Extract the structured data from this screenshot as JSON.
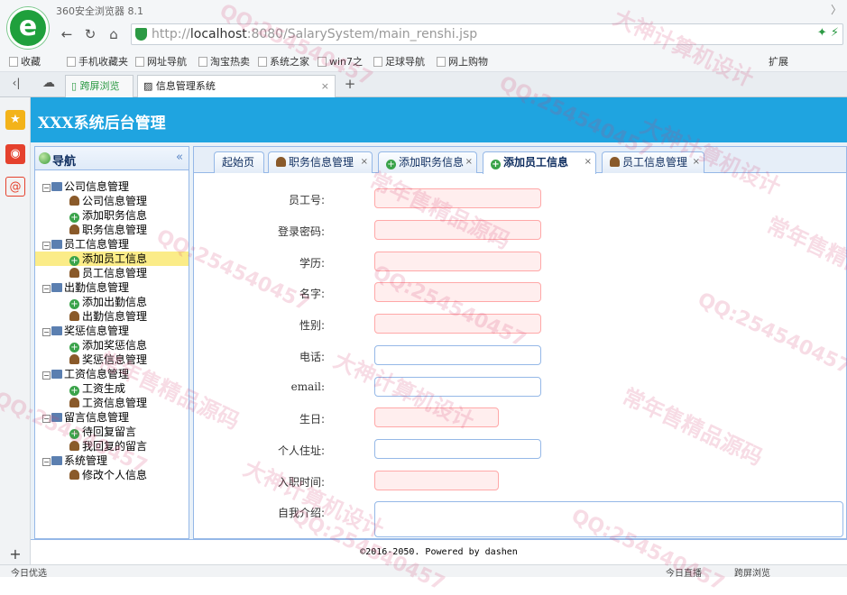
{
  "browser": {
    "title": "360安全浏览器 8.1",
    "url_prefix": "http://",
    "url_host": "localhost",
    "url_rest": ":8080/SalarySystem/main_renshi.jsp",
    "bookmarks": [
      "收藏",
      "手机收藏夹",
      "网址导航",
      "淘宝热卖",
      "系统之家",
      "win7之",
      "足球导航",
      "网上购物"
    ],
    "ext_label": "扩展",
    "tabs": [
      {
        "label": "跨屏浏览"
      },
      {
        "label": "信息管理系统"
      }
    ]
  },
  "app": {
    "title": "XXX系统后台管理",
    "nav_title": "导航",
    "collapse_glyph": "«",
    "tree": [
      {
        "label": "公司信息管理",
        "level": 0,
        "icon": "folder-computer-icon"
      },
      {
        "label": "公司信息管理",
        "level": 1,
        "icon": "person-icon"
      },
      {
        "label": "添加职务信息",
        "level": 1,
        "icon": "add-icon"
      },
      {
        "label": "职务信息管理",
        "level": 1,
        "icon": "person-icon"
      },
      {
        "label": "员工信息管理",
        "level": 0,
        "icon": "folder-computer-icon"
      },
      {
        "label": "添加员工信息",
        "level": 1,
        "icon": "add-icon",
        "selected": true
      },
      {
        "label": "员工信息管理",
        "level": 1,
        "icon": "person-icon"
      },
      {
        "label": "出勤信息管理",
        "level": 0,
        "icon": "folder-computer-icon"
      },
      {
        "label": "添加出勤信息",
        "level": 1,
        "icon": "add-icon"
      },
      {
        "label": "出勤信息管理",
        "level": 1,
        "icon": "person-icon"
      },
      {
        "label": "奖惩信息管理",
        "level": 0,
        "icon": "folder-computer-icon"
      },
      {
        "label": "添加奖惩信息",
        "level": 1,
        "icon": "add-icon"
      },
      {
        "label": "奖惩信息管理",
        "level": 1,
        "icon": "person-icon"
      },
      {
        "label": "工资信息管理",
        "level": 0,
        "icon": "folder-computer-icon"
      },
      {
        "label": "工资生成",
        "level": 1,
        "icon": "add-icon"
      },
      {
        "label": "工资信息管理",
        "level": 1,
        "icon": "person-icon"
      },
      {
        "label": "留言信息管理",
        "level": 0,
        "icon": "folder-computer-icon"
      },
      {
        "label": "待回复留言",
        "level": 1,
        "icon": "add-icon"
      },
      {
        "label": "我回复的留言",
        "level": 1,
        "icon": "person-icon"
      },
      {
        "label": "系统管理",
        "level": 0,
        "icon": "folder-computer-icon"
      },
      {
        "label": "修改个人信息",
        "level": 1,
        "icon": "person-icon"
      }
    ],
    "tabs": [
      {
        "label": "起始页",
        "icon": "",
        "closable": false
      },
      {
        "label": "职务信息管理",
        "icon": "person-icon",
        "closable": true
      },
      {
        "label": "添加职务信息",
        "icon": "add-icon",
        "closable": true
      },
      {
        "label": "添加员工信息",
        "icon": "add-icon",
        "closable": true,
        "active": true
      },
      {
        "label": "员工信息管理",
        "icon": "person-icon",
        "closable": true
      }
    ],
    "form": [
      {
        "label": "员工号:",
        "type": "text",
        "required": true,
        "value": ""
      },
      {
        "label": "登录密码:",
        "type": "text",
        "required": true,
        "value": ""
      },
      {
        "label": "学历:",
        "type": "text",
        "required": true,
        "value": ""
      },
      {
        "label": "名字:",
        "type": "text",
        "required": true,
        "value": ""
      },
      {
        "label": "性别:",
        "type": "text",
        "required": true,
        "value": ""
      },
      {
        "label": "电话:",
        "type": "text",
        "required": false,
        "value": ""
      },
      {
        "label": "email:",
        "type": "text",
        "required": false,
        "value": ""
      },
      {
        "label": "生日:",
        "type": "date",
        "required": true,
        "value": ""
      },
      {
        "label": "个人住址:",
        "type": "text",
        "required": false,
        "value": ""
      },
      {
        "label": "入职时间:",
        "type": "date",
        "required": true,
        "value": ""
      },
      {
        "label": "自我介绍:",
        "type": "textarea",
        "required": false,
        "value": ""
      }
    ],
    "footer": "©2016-2050. Powered by dashen"
  },
  "status": {
    "left": "今日优选",
    "right_1": "今日直播",
    "right_2": "跨屏浏览"
  },
  "watermarks": [
    "QQ:254540457",
    "大神计算机设计",
    "常年售精品源码"
  ],
  "colors": {
    "header": "#1fa4e0",
    "border": "#95b8e7",
    "required_bg": "#ffeeee",
    "selected": "#fbec88"
  }
}
